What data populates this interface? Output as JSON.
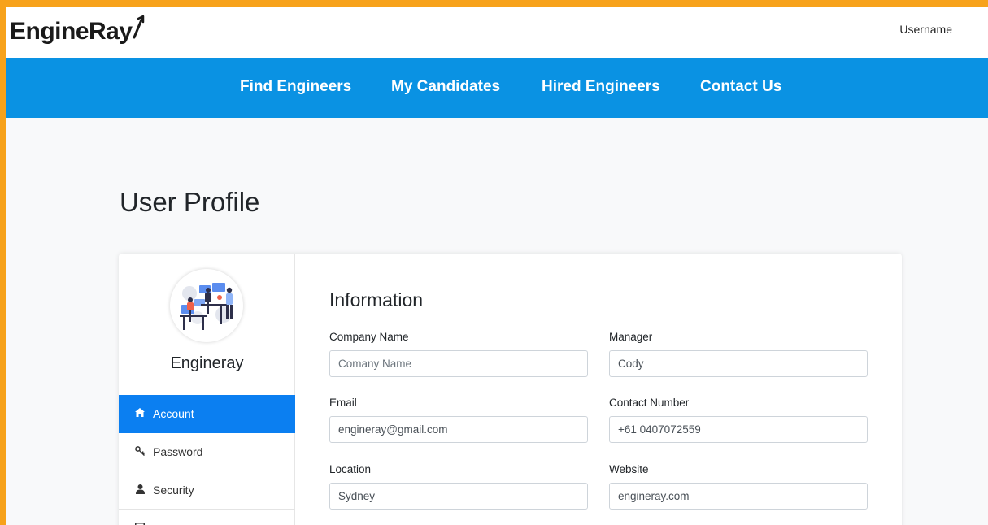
{
  "header": {
    "logo_text": "EngineRay",
    "username": "Username"
  },
  "nav": {
    "items": [
      {
        "label": "Find Engineers"
      },
      {
        "label": "My Candidates"
      },
      {
        "label": "Hired Engineers"
      },
      {
        "label": "Contact Us"
      }
    ]
  },
  "page": {
    "title": "User Profile"
  },
  "sidebar": {
    "company_name": "Engineray",
    "menu": [
      {
        "label": "Account",
        "icon": "home-icon",
        "active": true
      },
      {
        "label": "Password",
        "icon": "key-icon",
        "active": false
      },
      {
        "label": "Security",
        "icon": "user-icon",
        "active": false
      },
      {
        "label": "",
        "icon": "square-icon",
        "active": false
      }
    ]
  },
  "form": {
    "section_title": "Information",
    "company_name": {
      "label": "Company Name",
      "value": "",
      "placeholder": "Comany Name"
    },
    "manager": {
      "label": "Manager",
      "value": "Cody",
      "placeholder": ""
    },
    "email": {
      "label": "Email",
      "value": "engineray@gmail.com",
      "placeholder": ""
    },
    "contact_number": {
      "label": "Contact Number",
      "value": "+61 0407072559",
      "placeholder": ""
    },
    "location": {
      "label": "Location",
      "value": "Sydney",
      "placeholder": ""
    },
    "website": {
      "label": "Website",
      "value": "engineray.com",
      "placeholder": ""
    }
  },
  "colors": {
    "accent_orange": "#f7a21b",
    "nav_blue": "#0a92e3",
    "active_blue": "#0b7ff1"
  }
}
